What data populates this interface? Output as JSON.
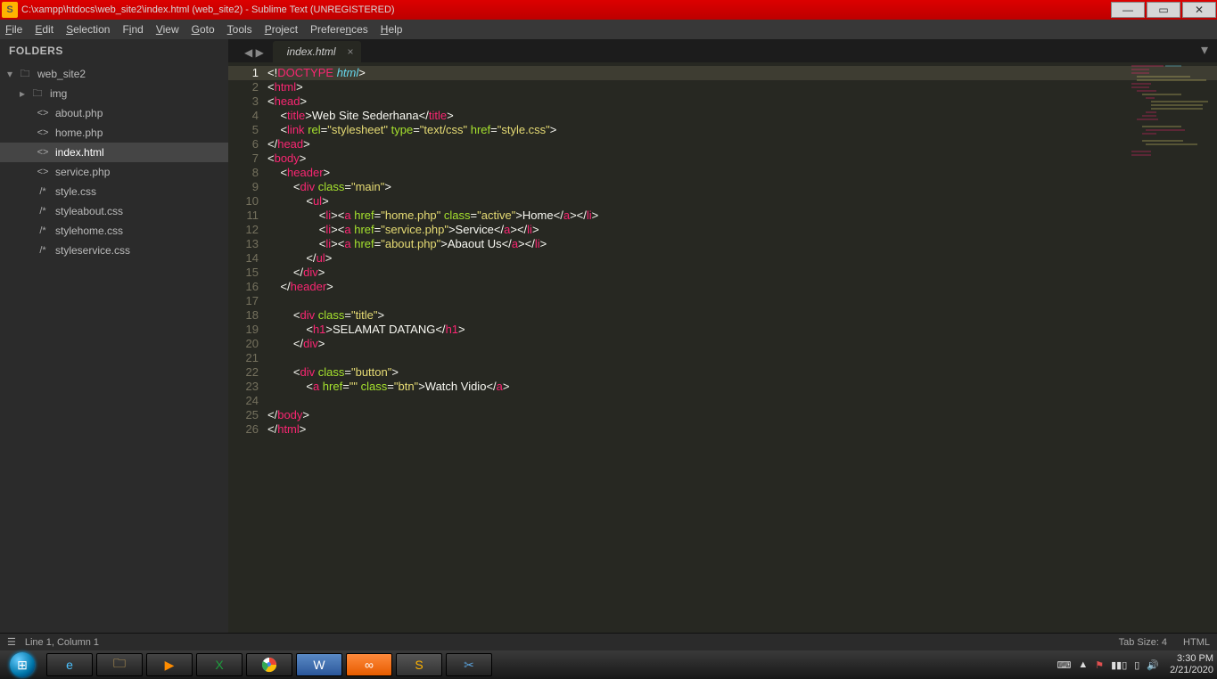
{
  "titlebar": {
    "title": "C:\\xampp\\htdocs\\web_site2\\index.html (web_site2) - Sublime Text (UNREGISTERED)"
  },
  "menus": [
    "File",
    "Edit",
    "Selection",
    "Find",
    "View",
    "Goto",
    "Tools",
    "Project",
    "Preferences",
    "Help"
  ],
  "sidebar": {
    "header": "FOLDERS",
    "project": "web_site2",
    "folder": "img",
    "files": [
      {
        "icon": "<>",
        "name": "about.php"
      },
      {
        "icon": "<>",
        "name": "home.php"
      },
      {
        "icon": "<>",
        "name": "index.html",
        "sel": true
      },
      {
        "icon": "<>",
        "name": "service.php"
      },
      {
        "icon": "/*",
        "name": "style.css"
      },
      {
        "icon": "/*",
        "name": "styleabout.css"
      },
      {
        "icon": "/*",
        "name": "stylehome.css"
      },
      {
        "icon": "/*",
        "name": "styleservice.css"
      }
    ]
  },
  "tab": {
    "name": "index.html"
  },
  "lines": 26,
  "currentLine": 1,
  "code": {
    "title_text": "Web Site Sederhana",
    "link_href": "style.css",
    "nav": [
      {
        "href": "home.php",
        "extra_attr": " class=\"active\"",
        "text": "Home"
      },
      {
        "href": "service.php",
        "extra_attr": "",
        "text": "Service"
      },
      {
        "href": "about.php",
        "extra_attr": "",
        "text": "Abaout Us"
      }
    ],
    "h1_text": "SELAMAT DATANG",
    "btn_text": "Watch Vidio"
  },
  "status": {
    "left": "Line 1, Column 1",
    "tab": "Tab Size: 4",
    "lang": "HTML"
  },
  "tray": {
    "time": "3:30 PM",
    "date": "2/21/2020"
  }
}
